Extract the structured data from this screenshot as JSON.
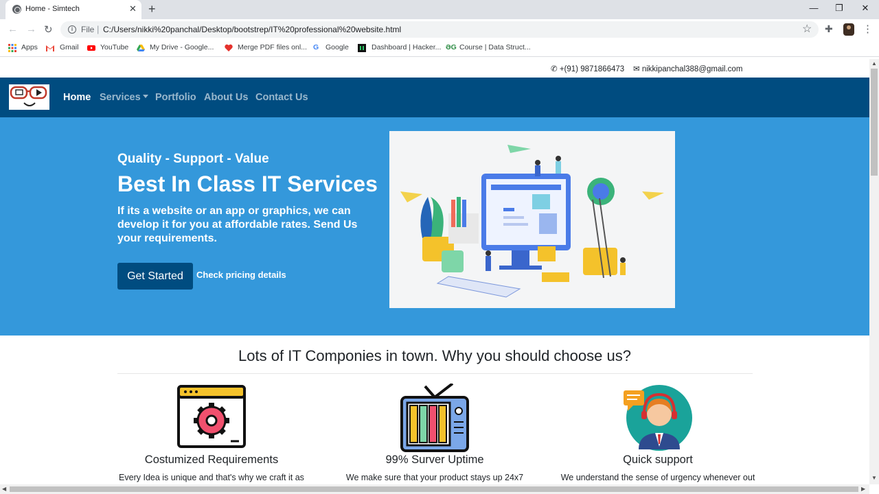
{
  "browser": {
    "tab_title": "Home - Simtech",
    "new_tab": "+",
    "close": "✕",
    "win_min": "—",
    "win_max": "❐",
    "win_close": "✕",
    "file_label": "File",
    "url": "C:/Users/nikki%20panchal/Desktop/bootstrep/IT%20professional%20website.html",
    "bookmarks": [
      "Apps",
      "Gmail",
      "YouTube",
      "My Drive - Google...",
      "Merge PDF files onl...",
      "Google",
      "Dashboard | Hacker...",
      "Course | Data Struct..."
    ]
  },
  "topinfo": {
    "phone": "+(91) 9871866473",
    "email": "nikkipanchal388@gmail.com"
  },
  "nav": {
    "items": [
      "Home",
      "Services",
      "Portfolio",
      "About Us",
      "Contact Us"
    ]
  },
  "hero": {
    "tagline": "Quality - Support - Value",
    "headline": "Best In Class IT Services",
    "lede": "If its a website or an app or graphics, we can develop it for you at affordable rates. Send Us your requirements.",
    "cta": "Get Started",
    "secondary": "Check pricing details"
  },
  "features": {
    "title": "Lots of IT Componies in town. Why you should choose us?",
    "items": [
      {
        "heading": "Costumized Requirements",
        "text": "Every Idea is unique and that's why we craft it as",
        "icon": "gear-window-icon"
      },
      {
        "heading": "99% Surver Uptime",
        "text": "We make sure that your product stays up 24x7",
        "icon": "tv-icon"
      },
      {
        "heading": "Quick support",
        "text": "We understand the sense of urgency whenever out",
        "icon": "support-agent-icon"
      }
    ]
  },
  "colors": {
    "navbar": "#004c80",
    "hero": "#3498db",
    "button": "#004c80"
  }
}
